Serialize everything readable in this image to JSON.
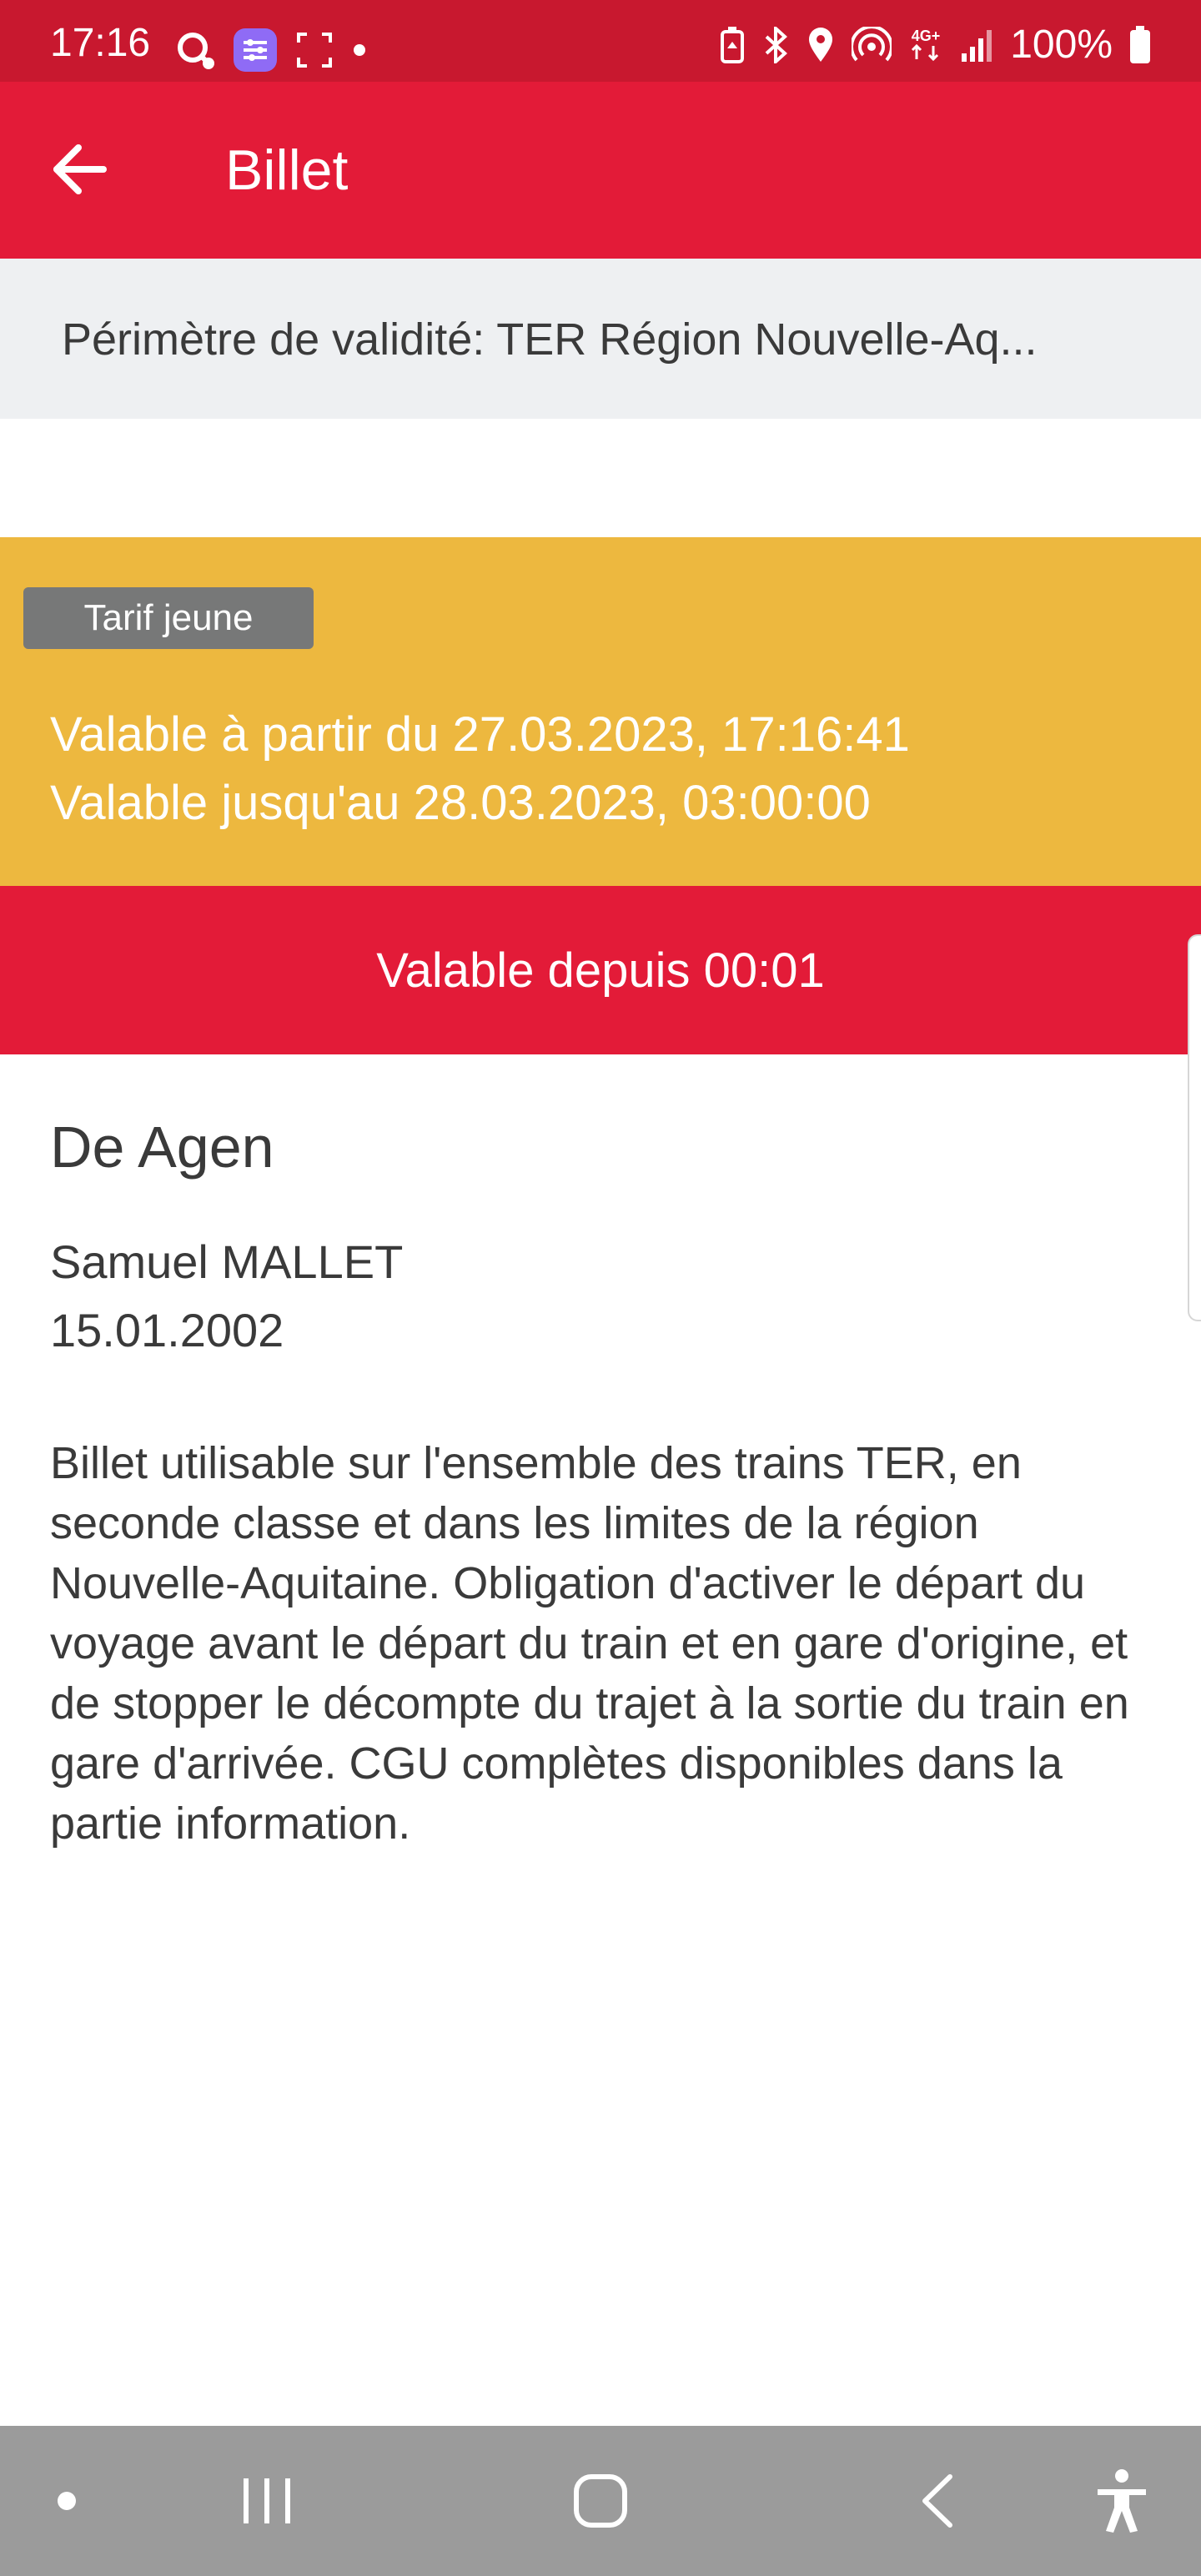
{
  "status_bar": {
    "time": "17:16",
    "battery": "100%",
    "left_icons": [
      "search-notification-icon",
      "settings-app-icon",
      "screenshot-icon",
      "dot-icon"
    ],
    "right_icons": [
      "battery-saver-icon",
      "bluetooth-icon",
      "location-icon",
      "hotspot-icon",
      "4g-data-icon",
      "signal-icon",
      "battery-icon"
    ]
  },
  "app_bar": {
    "title": "Billet",
    "back_icon": "arrow-left-icon"
  },
  "scope": {
    "text": "Périmètre de validité: TER Région Nouvelle-Aq..."
  },
  "validity": {
    "tariff_badge": "Tarif jeune",
    "valid_from": "Valable à partir du 27.03.2023, 17:16:41",
    "valid_until": "Valable jusqu'au 28.03.2023, 03:00:00"
  },
  "active_timer": {
    "text": "Valable depuis 00:01"
  },
  "ticket": {
    "origin": "De Agen",
    "passenger_name": "Samuel MALLET",
    "birth_date": "15.01.2002",
    "terms": "Billet utilisable sur l'ensemble des trains TER, en seconde classe et dans les limites de la région Nouvelle-Aquitaine. Obligation d'activer le départ du voyage avant le départ du train et en gare d'origine, et de stopper le décompte du trajet à la sortie du train en gare d'arrivée. CGU complètes disponibles dans la partie information."
  },
  "nav_bar": {
    "items": [
      "dot-icon",
      "recent-apps-icon",
      "home-icon",
      "back-icon",
      "accessibility-icon"
    ]
  },
  "colors": {
    "status_bar": "#c8182f",
    "primary_red": "#e31b38",
    "validity_yellow": "#edb83f",
    "badge_gray": "#777878",
    "scope_bg": "#eef0f2",
    "text_dark": "#3a3a3a",
    "nav_bar": "#9b9b9b"
  }
}
